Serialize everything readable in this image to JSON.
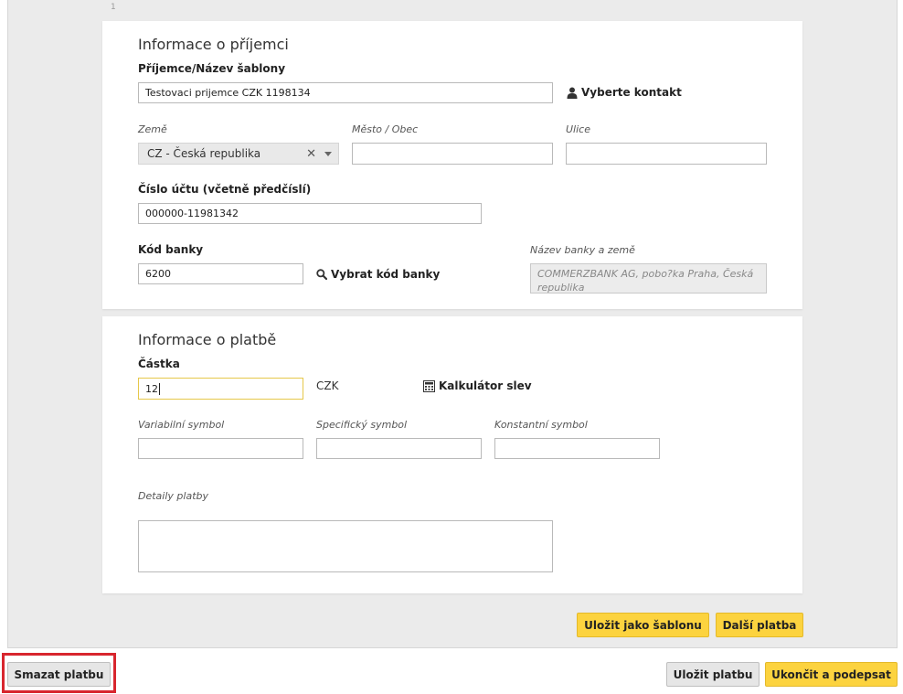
{
  "step_number": "1",
  "recipient": {
    "title": "Informace o příjemci",
    "name_label": "Příjemce/Název šablony",
    "name_value": "Testovaci prijemce CZK 1198134",
    "choose_contact": "Vyberte kontakt",
    "country_label": "Země",
    "country_value": "CZ - Česká republika",
    "city_label": "Město / Obec",
    "city_value": "",
    "street_label": "Ulice",
    "street_value": "",
    "account_label": "Číslo účtu (včetně předčíslí)",
    "account_value": "000000-11981342",
    "bank_code_label": "Kód banky",
    "bank_code_value": "6200",
    "choose_bank_code": "Vybrat kód banky",
    "bank_name_label": "Název banky a země",
    "bank_name_value": "COMMERZBANK AG, pobo?ka Praha, Česká republika"
  },
  "payment": {
    "title": "Informace o platbě",
    "amount_label": "Částka",
    "amount_value": "12",
    "currency": "CZK",
    "discount_calc": "Kalkulátor slev",
    "variable_symbol_label": "Variabilní symbol",
    "variable_symbol_value": "",
    "specific_symbol_label": "Specifický symbol",
    "specific_symbol_value": "",
    "constant_symbol_label": "Konstantní symbol",
    "constant_symbol_value": "",
    "details_label": "Detaily platby",
    "details_value": ""
  },
  "buttons": {
    "save_template": "Uložit jako šablonu",
    "next_payment": "Další platba",
    "delete_payment": "Smazat platbu",
    "save_payment": "Uložit platbu",
    "finish_sign": "Ukončit a podepsat"
  },
  "colors": {
    "primary_button": "#fcd33f",
    "secondary_button": "#e6e6e6",
    "highlight_frame": "#d8262e",
    "focus_border": "#e6c84a"
  },
  "icons": {
    "contact": "user-icon",
    "bank_search": "search-icon",
    "calculator": "calculator-icon",
    "clear": "clear-icon",
    "dropdown": "chevron-down-icon"
  }
}
